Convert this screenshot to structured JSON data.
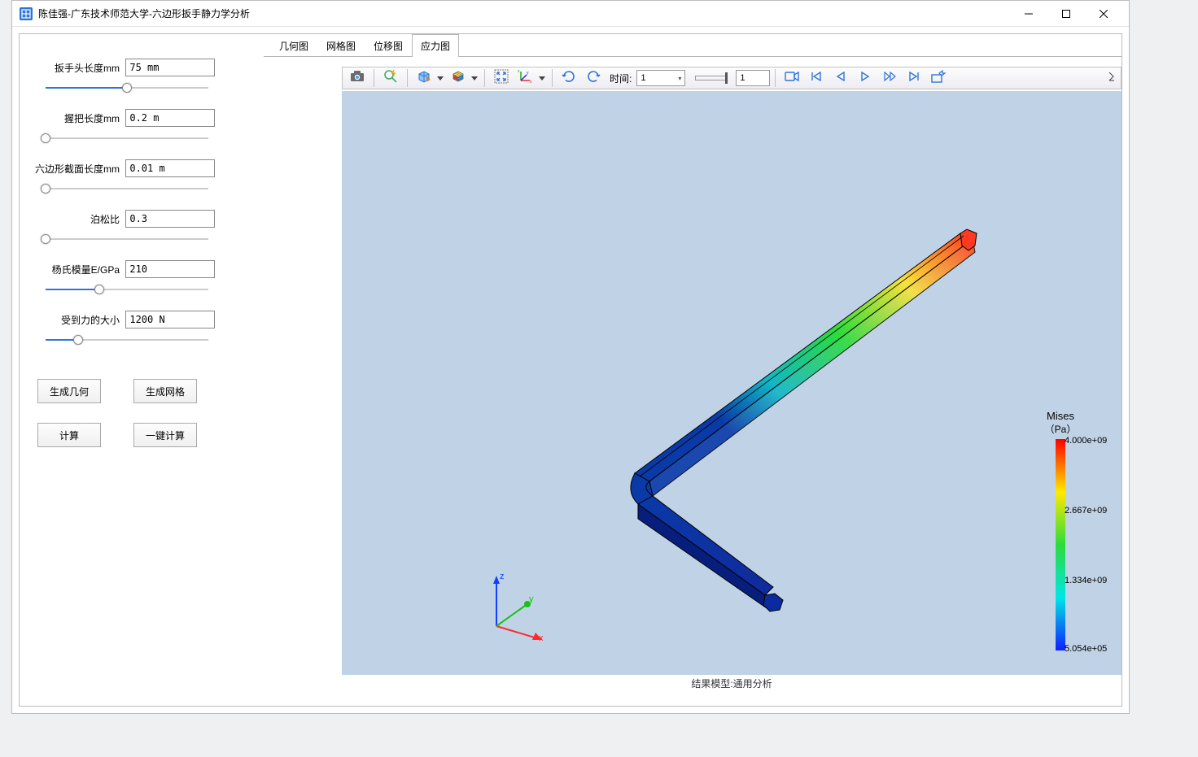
{
  "window": {
    "title": "陈佳强-广东技术师范大学-六边形扳手静力学分析"
  },
  "params": {
    "head_length": {
      "label": "扳手头长度mm",
      "value": "75 mm",
      "slider": 50
    },
    "grip_length": {
      "label": "握把长度mm",
      "value": "0.2 m",
      "slider": 0
    },
    "hex_section": {
      "label": "六边形截面长度mm",
      "value": "0.01 m",
      "slider": 0
    },
    "poisson": {
      "label": "泊松比",
      "value": "0.3",
      "slider": 0
    },
    "youngs": {
      "label": "杨氏模量E/GPa",
      "value": "210",
      "slider": 33
    },
    "force": {
      "label": "受到力的大小",
      "value": "1200 N",
      "slider": 20
    }
  },
  "buttons": {
    "gen_geom": "生成几何",
    "gen_mesh": "生成网格",
    "calc": "计算",
    "one_click": "一键计算"
  },
  "tabs": {
    "t1": "几何图",
    "t2": "网格图",
    "t3": "位移图",
    "t4": "应力图",
    "active": "t4"
  },
  "toolbar": {
    "time_label": "时间:",
    "time_value": "1",
    "frame_value": "1"
  },
  "legend": {
    "title": "Mises",
    "unit": "（Pa）",
    "v0": "4.000e+09",
    "v1": "2.667e+09",
    "v2": "1.334e+09",
    "v3": "5.054e+05"
  },
  "status": {
    "text": "结果模型:通用分析"
  },
  "axes": {
    "x": "x",
    "y": "y",
    "z": "z"
  }
}
